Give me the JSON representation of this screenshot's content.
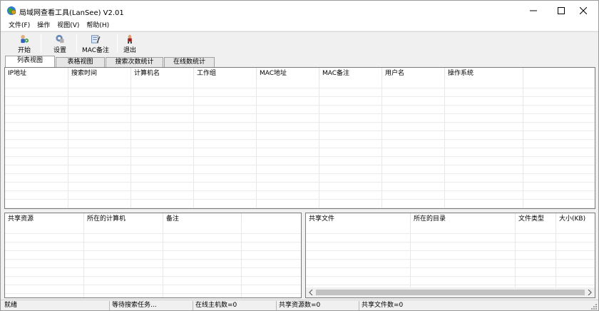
{
  "window": {
    "title": "局域网查看工具(LanSee) V2.01",
    "controls": {
      "minimize": "—",
      "maximize": "☐",
      "close": "✕"
    }
  },
  "menu": {
    "items": [
      "文件(F)",
      "操作",
      "视图(V)",
      "帮助(H)"
    ]
  },
  "toolbar": {
    "buttons": [
      {
        "label": "开始",
        "icon": "start-icon"
      },
      {
        "label": "设置",
        "icon": "settings-icon"
      },
      {
        "label": "MAC备注",
        "icon": "mac-note-icon"
      },
      {
        "label": "退出",
        "icon": "exit-icon"
      }
    ]
  },
  "tabs": {
    "items": [
      "列表视图",
      "表格视图",
      "搜索次数统计",
      "在线数统计"
    ],
    "active_index": 0
  },
  "main_grid": {
    "columns": [
      "IP地址",
      "搜索时间",
      "计算机名",
      "工作组",
      "MAC地址",
      "MAC备注",
      "用户名",
      "操作系统"
    ],
    "rows": []
  },
  "shares_grid": {
    "columns": [
      "共享资源",
      "所在的计算机",
      "备注"
    ],
    "rows": []
  },
  "files_grid": {
    "columns": [
      "共享文件",
      "所在的目录",
      "文件类型",
      "大小(KB)"
    ],
    "rows": []
  },
  "statusbar": {
    "cells": [
      "就绪",
      "等待搜索任务...",
      "在线主机数=0",
      "共享资源数=0",
      "共享文件数=0"
    ]
  },
  "colors": {
    "grid_border": "#7a7a7a",
    "background": "#f0f0f0",
    "scroll_thumb": "#c2c2c2"
  }
}
